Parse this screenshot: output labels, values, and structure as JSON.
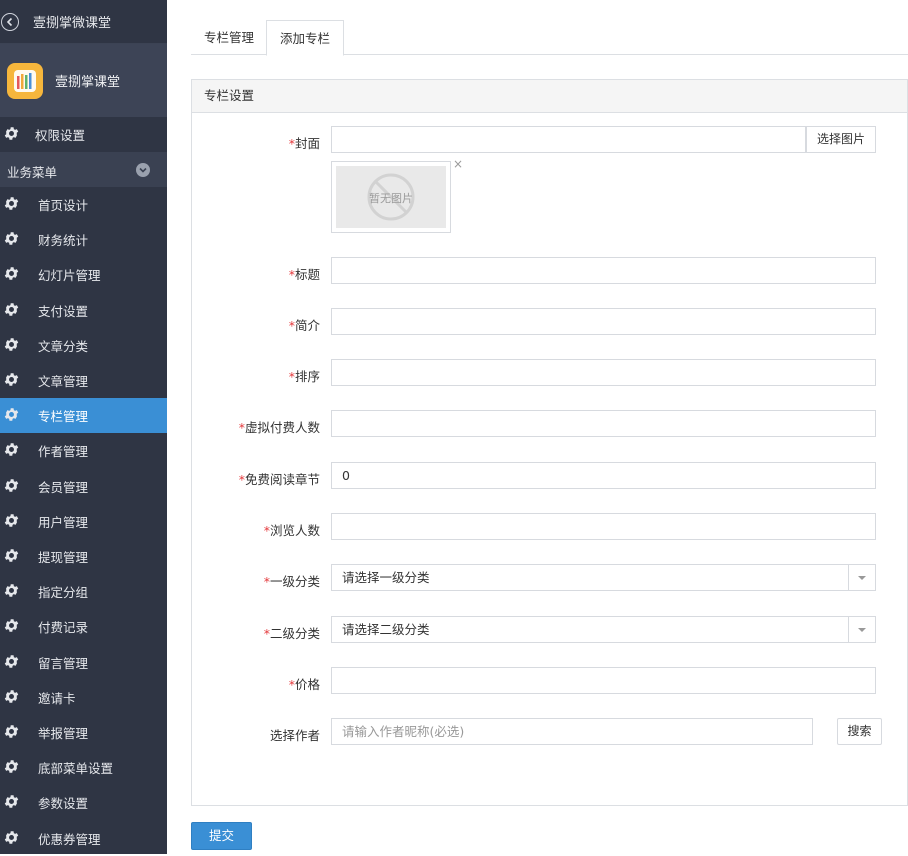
{
  "sidebar": {
    "back_title": "壹捌掌微课堂",
    "app_name": "壹捌掌课堂",
    "top_item": "权限设置",
    "group_label": "业务菜单",
    "items": [
      {
        "label": "首页设计",
        "icon": "gear-icon"
      },
      {
        "label": "财务统计",
        "icon": "gear-icon"
      },
      {
        "label": "幻灯片管理",
        "icon": "gear-icon"
      },
      {
        "label": "支付设置",
        "icon": "gear-icon"
      },
      {
        "label": "文章分类",
        "icon": "gear-icon"
      },
      {
        "label": "文章管理",
        "icon": "gear-icon"
      },
      {
        "label": "专栏管理",
        "icon": "gear-icon",
        "active": true
      },
      {
        "label": "作者管理",
        "icon": "gear-icon"
      },
      {
        "label": "会员管理",
        "icon": "gear-icon"
      },
      {
        "label": "用户管理",
        "icon": "gear-icon"
      },
      {
        "label": "提现管理",
        "icon": "gear-icon"
      },
      {
        "label": "指定分组",
        "icon": "gear-icon"
      },
      {
        "label": "付费记录",
        "icon": "gear-icon"
      },
      {
        "label": "留言管理",
        "icon": "gear-icon"
      },
      {
        "label": "邀请卡",
        "icon": "gear-icon"
      },
      {
        "label": "举报管理",
        "icon": "gear-icon"
      },
      {
        "label": "底部菜单设置",
        "icon": "gear-icon"
      },
      {
        "label": "参数设置",
        "icon": "gear-icon"
      },
      {
        "label": "优惠券管理",
        "icon": "gear-icon"
      }
    ],
    "active_color": "#3a8fd5",
    "bg_color": "#2f3544"
  },
  "tabs": [
    {
      "label": "专栏管理"
    },
    {
      "label": "添加专栏",
      "active": true
    }
  ],
  "panel": {
    "title": "专栏设置"
  },
  "form": {
    "required_mark": "*",
    "cover_label": "封面",
    "cover_button": "选择图片",
    "cover_placeholder_image_text": "暂无图片",
    "close_glyph": "×",
    "title_label": "标题",
    "intro_label": "简介",
    "sort_label": "排序",
    "virtual_payers_label": "虚拟付费人数",
    "free_chapters_label": "免费阅读章节",
    "free_chapters_value": "0",
    "views_label": "浏览人数",
    "category1_label": "一级分类",
    "category1_value": "请选择一级分类",
    "category2_label": "二级分类",
    "category2_value": "请选择二级分类",
    "price_label": "价格",
    "author_label": "选择作者",
    "author_placeholder": "请输入作者昵称(必选)",
    "search_button": "搜索"
  },
  "submit_label": "提交"
}
